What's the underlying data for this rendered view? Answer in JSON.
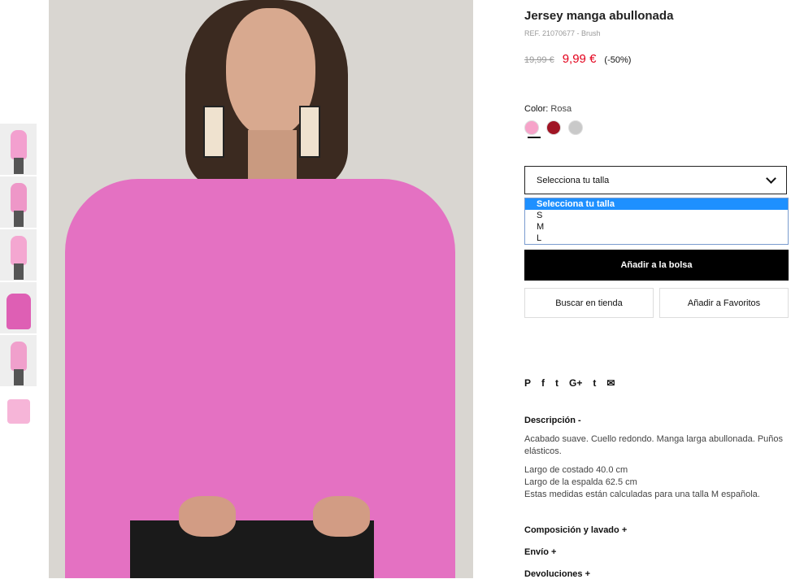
{
  "thumbnails": [
    {
      "label": "thumb-1",
      "color": "#f3a0cf"
    },
    {
      "label": "thumb-2",
      "color": "#ee97c8"
    },
    {
      "label": "thumb-3",
      "color": "#f4a7d1"
    },
    {
      "label": "thumb-4",
      "color": "#de5fb4"
    },
    {
      "label": "thumb-5",
      "color": "#f0a0cc"
    },
    {
      "label": "thumb-6",
      "color": "#f6b5d8"
    }
  ],
  "product": {
    "title": "Jersey manga abullonada",
    "ref": "REF. 21070677 - Brush",
    "old_price": "19,99 €",
    "new_price": "9,99 €",
    "discount": "(-50%)",
    "color_label": "Color:",
    "color_value": "Rosa",
    "swatches": [
      {
        "name": "rosa",
        "color": "#f6a3c9"
      },
      {
        "name": "rojo",
        "color": "#a01424"
      },
      {
        "name": "gris",
        "color": "#c9c9c9"
      }
    ]
  },
  "size_select": {
    "placeholder": "Selecciona tu talla",
    "options": [
      "Selecciona tu talla",
      "S",
      "M",
      "L"
    ]
  },
  "buttons": {
    "add_to_bag": "Añadir a la bolsa",
    "find_in_store": "Buscar en tienda",
    "add_to_favorites": "Añadir a Favoritos"
  },
  "social": [
    "P",
    "f",
    "t",
    "G+",
    "t",
    "✉"
  ],
  "description": {
    "heading": "Descripción",
    "toggle": "-",
    "p1": "Acabado suave. Cuello redondo. Manga larga abullonada. Puños elásticos.",
    "lines": [
      "Largo de costado 40.0 cm",
      "Largo de la espalda 62.5 cm",
      "Estas medidas están calculadas para una talla M española."
    ]
  },
  "accordions": [
    {
      "label": "Composición y lavado",
      "toggle": "+"
    },
    {
      "label": "Envío",
      "toggle": "+"
    },
    {
      "label": "Devoluciones",
      "toggle": "+"
    }
  ],
  "colors": {
    "price_red": "#e3001b",
    "select_blue": "#1e90ff",
    "sweater_pink": "#e471c2"
  }
}
